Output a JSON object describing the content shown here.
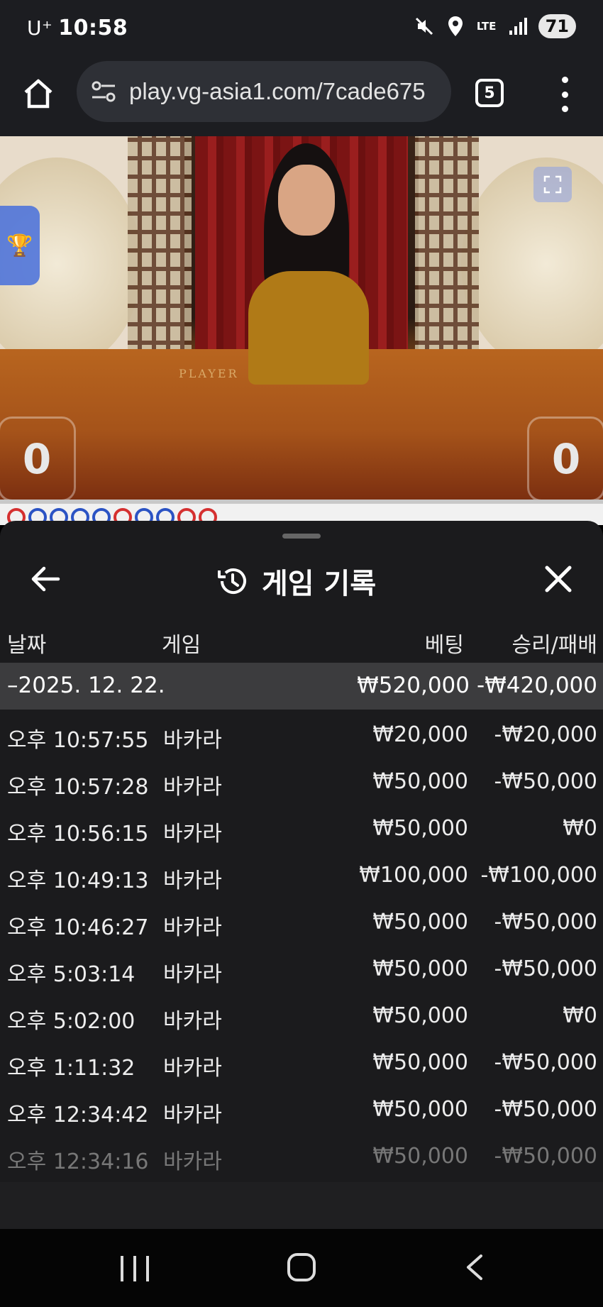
{
  "status_bar": {
    "carrier": "U⁺",
    "time": "10:58",
    "network": "LTE",
    "battery": "71",
    "icons": [
      "mute-icon",
      "location-icon",
      "lte-icon",
      "signal-icon",
      "battery-icon"
    ]
  },
  "browser": {
    "url": "play.vg-asia1.com/7cade675",
    "tab_count": "5"
  },
  "game": {
    "table_label": "PLAYER",
    "player_score": "0",
    "banker_score": "0",
    "colors": {
      "table": "#a5531a",
      "curtain": "#7b1414",
      "road_blue": "#2b53c4",
      "road_red": "#d53030"
    }
  },
  "history": {
    "title": "게임 기록",
    "columns": {
      "date": "날짜",
      "game": "게임",
      "bet": "베팅",
      "win_loss": "승리/패배"
    },
    "summary": {
      "date": "–2025. 12. 22.",
      "bet": "₩520,000",
      "win_loss": "-₩420,000"
    },
    "rows": [
      {
        "time": "오후 10:57:55",
        "game": "바카라",
        "bet": "₩20,000",
        "win_loss": "-₩20,000"
      },
      {
        "time": "오후 10:57:28",
        "game": "바카라",
        "bet": "₩50,000",
        "win_loss": "-₩50,000"
      },
      {
        "time": "오후 10:56:15",
        "game": "바카라",
        "bet": "₩50,000",
        "win_loss": "₩0"
      },
      {
        "time": "오후 10:49:13",
        "game": "바카라",
        "bet": "₩100,000",
        "win_loss": "-₩100,000"
      },
      {
        "time": "오후 10:46:27",
        "game": "바카라",
        "bet": "₩50,000",
        "win_loss": "-₩50,000"
      },
      {
        "time": "오후 5:03:14",
        "game": "바카라",
        "bet": "₩50,000",
        "win_loss": "-₩50,000"
      },
      {
        "time": "오후 5:02:00",
        "game": "바카라",
        "bet": "₩50,000",
        "win_loss": "₩0"
      },
      {
        "time": "오후 1:11:32",
        "game": "바카라",
        "bet": "₩50,000",
        "win_loss": "-₩50,000"
      },
      {
        "time": "오후 12:34:42",
        "game": "바카라",
        "bet": "₩50,000",
        "win_loss": "-₩50,000"
      },
      {
        "time": "오후 12:34:16",
        "game": "바카라",
        "bet": "₩50,000",
        "win_loss": "-₩50,000"
      }
    ]
  }
}
